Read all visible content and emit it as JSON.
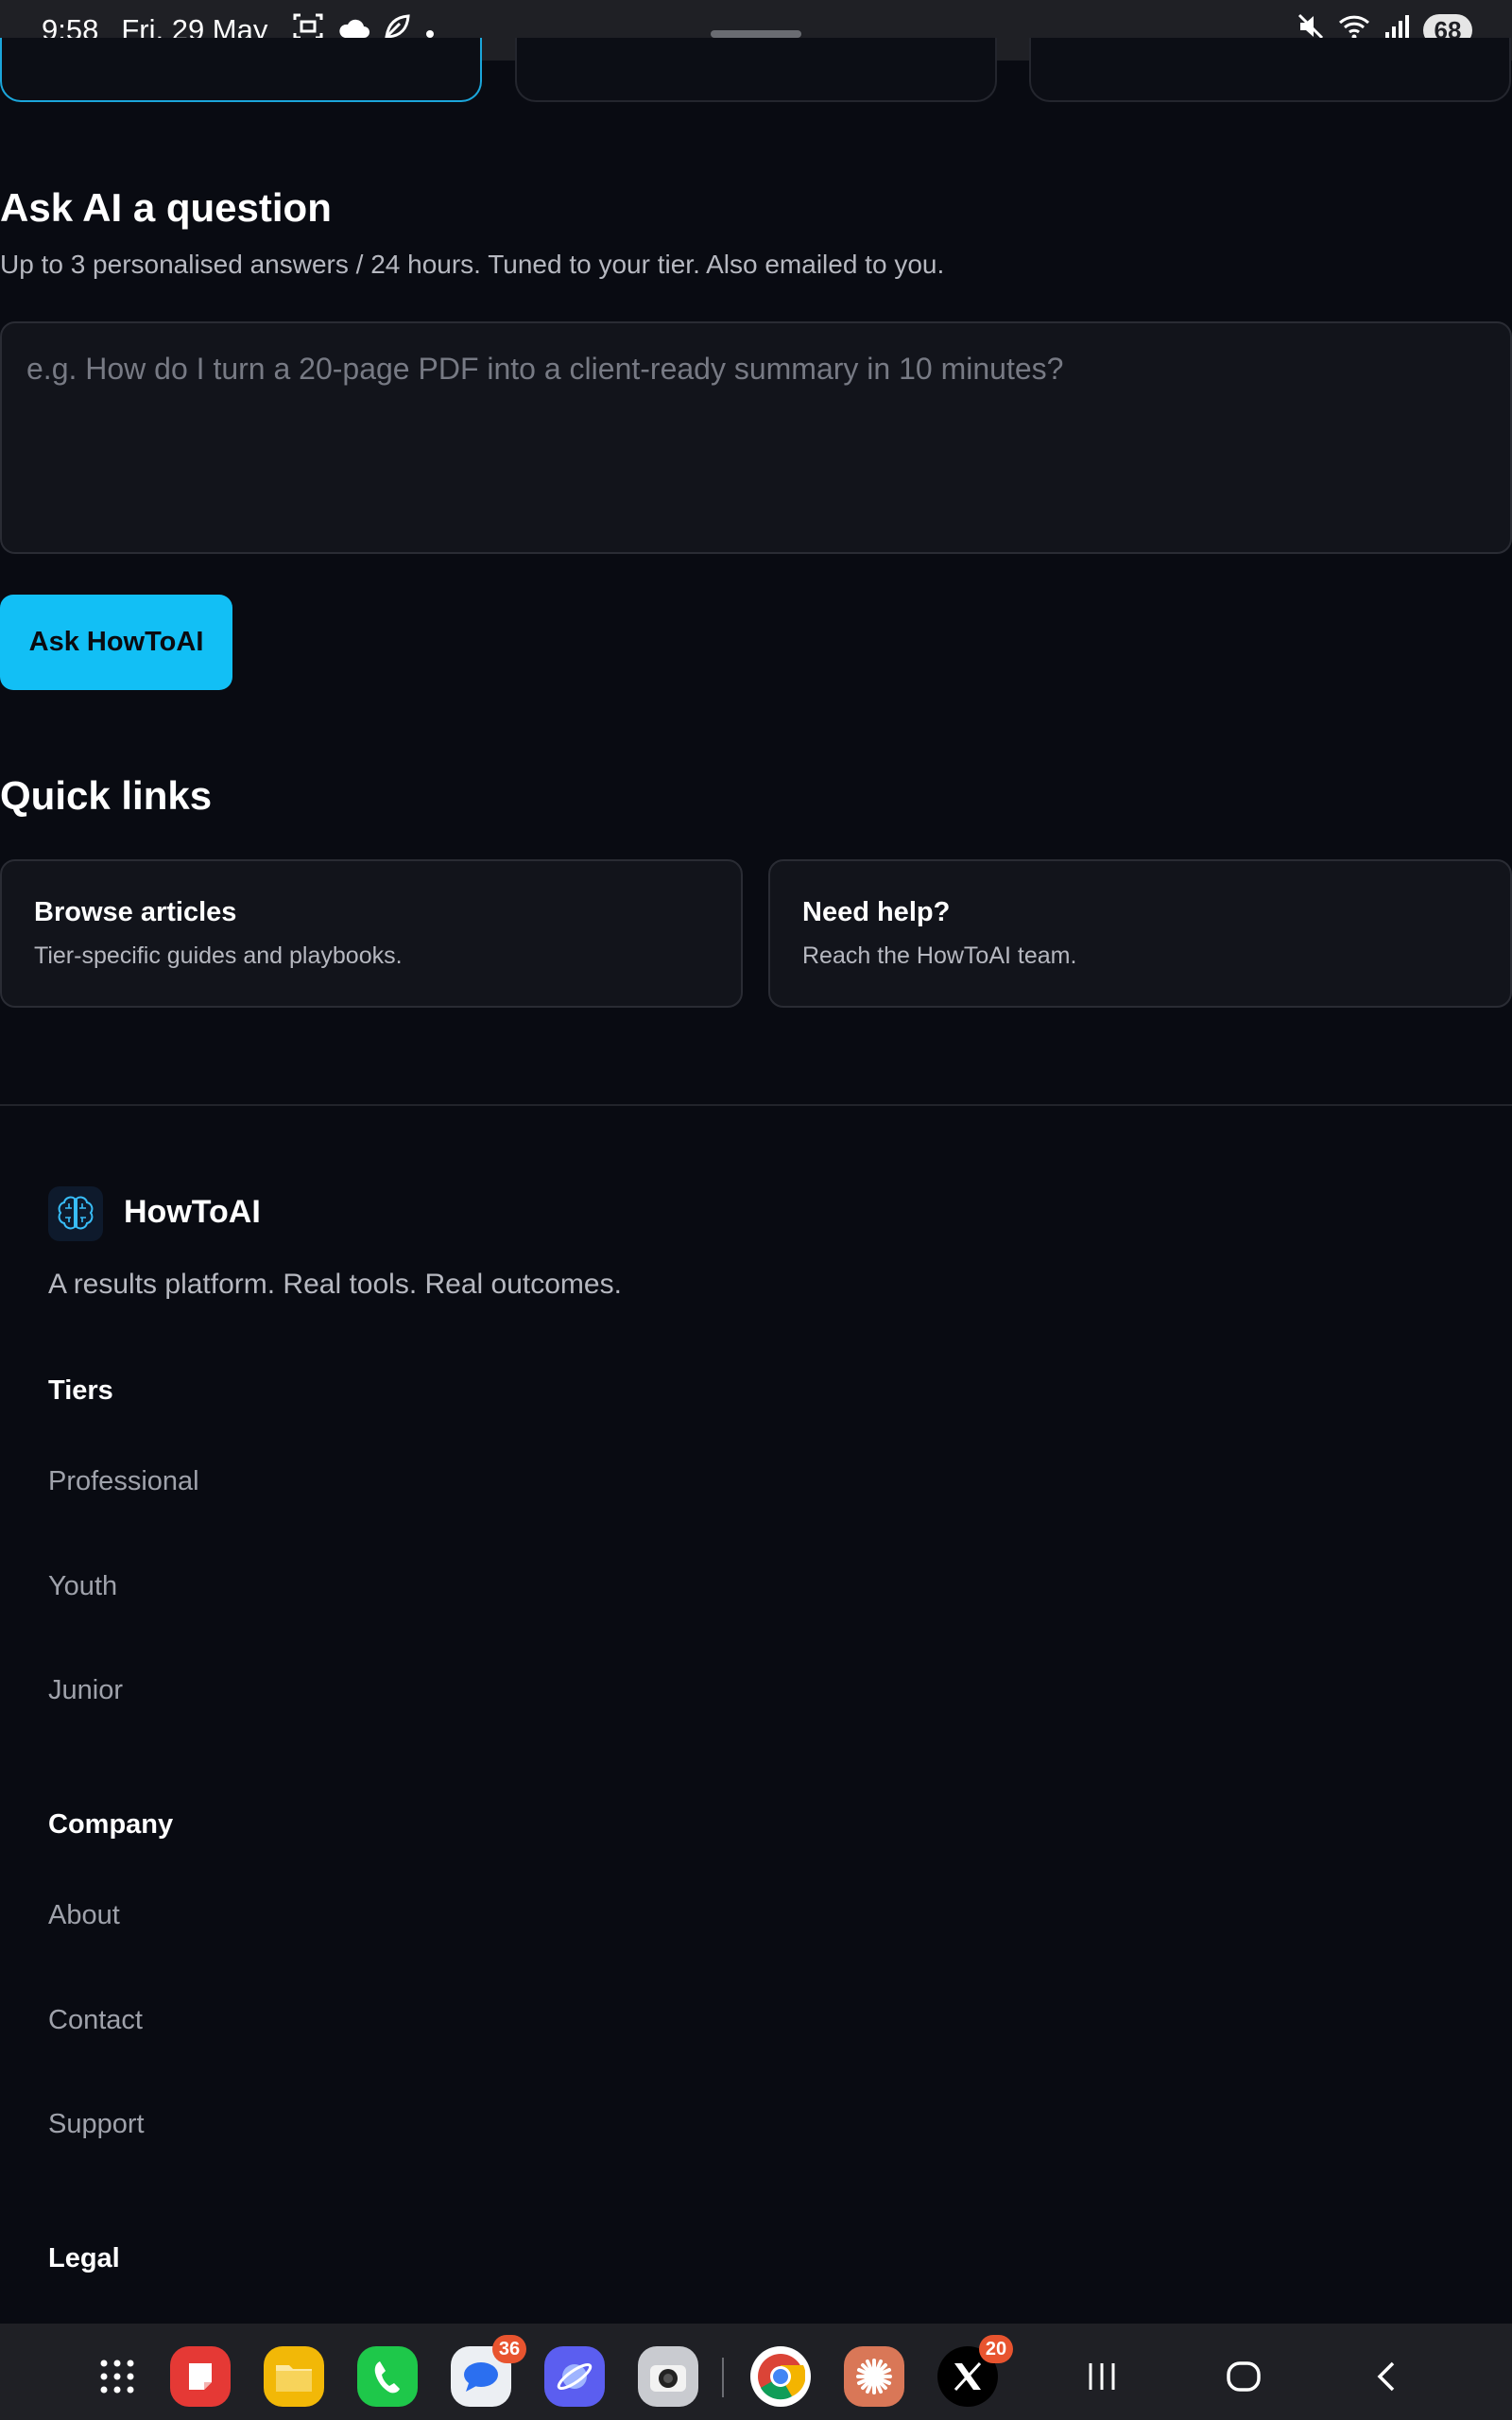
{
  "status_bar": {
    "time": "9:58",
    "date": "Fri, 29 May",
    "left_icons": [
      "screenshot-icon",
      "cloud-icon",
      "leaf-icon",
      "dot-icon"
    ],
    "right_icons": [
      "mute-icon",
      "wifi-icon",
      "signal-icon"
    ],
    "battery": "68"
  },
  "ask": {
    "title": "Ask AI a question",
    "subtitle": "Up to 3 personalised answers / 24 hours. Tuned to your tier. Also emailed to you.",
    "placeholder": "e.g. How do I turn a 20-page PDF into a client-ready summary in 10 minutes?",
    "button_label": "Ask HowToAI"
  },
  "quick_links": {
    "title": "Quick links",
    "cards": [
      {
        "title": "Browse articles",
        "desc": "Tier-specific guides and playbooks."
      },
      {
        "title": "Need help?",
        "desc": "Reach the HowToAI team."
      }
    ]
  },
  "footer": {
    "brand": "HowToAI",
    "tagline": "A results platform. Real tools. Real outcomes.",
    "tiers": {
      "heading": "Tiers",
      "links": [
        "Professional",
        "Youth",
        "Junior"
      ]
    },
    "company": {
      "heading": "Company",
      "links": [
        "About",
        "Contact",
        "Support"
      ]
    },
    "legal": {
      "heading": "Legal"
    }
  },
  "dock": {
    "apps": [
      {
        "icon": "app-grid-icon"
      },
      {
        "icon": "notes-app-icon",
        "color": "#e53935"
      },
      {
        "icon": "files-app-icon",
        "color": "#f2b807"
      },
      {
        "icon": "phone-app-icon",
        "color": "#1ec84a"
      },
      {
        "icon": "messages-app-icon",
        "color": "#eceff3",
        "badge": "36"
      },
      {
        "icon": "browser-app-icon",
        "color": "#5b5ef0"
      },
      {
        "icon": "camera-app-icon",
        "color": "#c9cbd0"
      },
      {
        "icon": "chrome-app-icon",
        "color": "#ffffff"
      },
      {
        "icon": "claude-app-icon",
        "color": "#d97757"
      },
      {
        "icon": "x-app-icon",
        "color": "#000000",
        "badge": "20"
      }
    ],
    "nav": [
      "recents-icon",
      "home-icon",
      "back-icon"
    ]
  },
  "colors": {
    "accent": "#12bff5",
    "background": "#090b12",
    "card": "#12141b"
  }
}
